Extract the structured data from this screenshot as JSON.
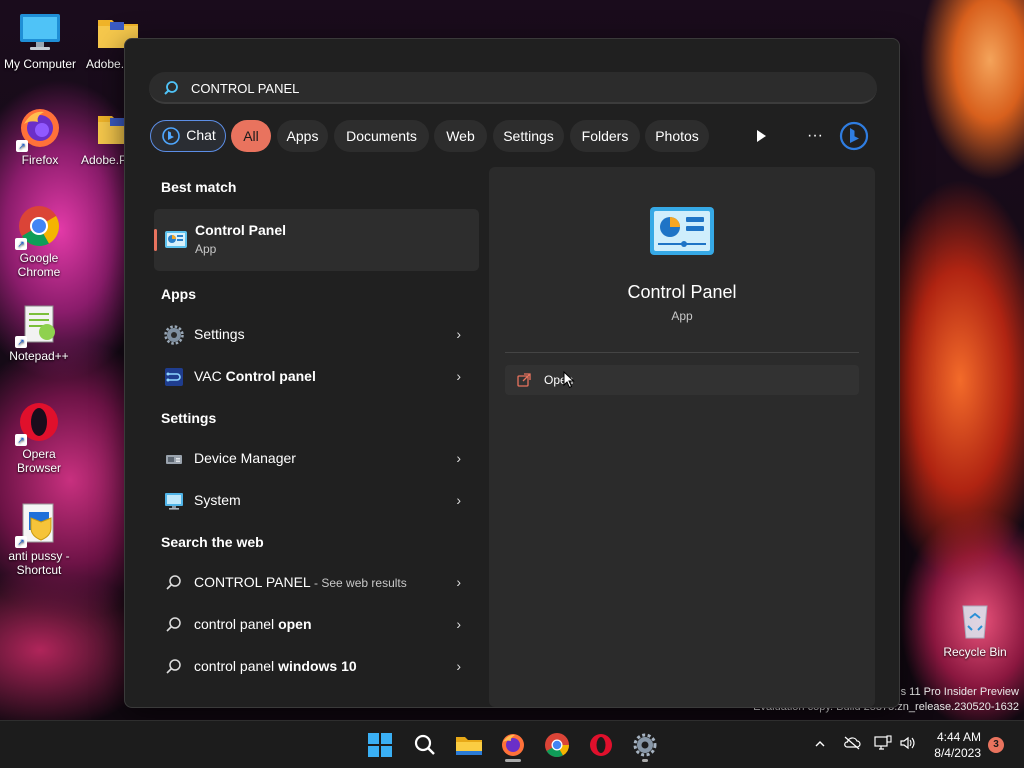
{
  "desktop": {
    "icons": [
      {
        "label": "My Computer"
      },
      {
        "label": "Adobe.I"
      },
      {
        "label": "Firefox"
      },
      {
        "label": "Adobe.P"
      },
      {
        "label": "Google Chrome"
      },
      {
        "label": "Notepad++"
      },
      {
        "label": "Opera Browser"
      },
      {
        "label": "anti pussy - Shortcut"
      },
      {
        "label": "Recycle Bin"
      }
    ],
    "watermark": {
      "line1": "s 11 Pro Insider Preview",
      "line2": "Evaluation copy. Build 25375.zn_release.230520-1632"
    }
  },
  "search": {
    "value": "CONTROL PANEL",
    "placeholder": "",
    "filters": [
      {
        "label": "Chat",
        "active": false
      },
      {
        "label": "All",
        "active": true
      },
      {
        "label": "Apps",
        "active": false
      },
      {
        "label": "Documents",
        "active": false
      },
      {
        "label": "Web",
        "active": false
      },
      {
        "label": "Settings",
        "active": false
      },
      {
        "label": "Folders",
        "active": false
      },
      {
        "label": "Photos",
        "active": false
      }
    ],
    "more_label": "···"
  },
  "results": {
    "best_match_heading": "Best match",
    "best_match": {
      "name": "Control Panel",
      "type": "App"
    },
    "apps_heading": "Apps",
    "apps": [
      {
        "name": "Settings",
        "icon": "gear-icon"
      },
      {
        "pre": "VAC ",
        "bold": "Control panel",
        "icon": "vac-icon"
      }
    ],
    "settings_heading": "Settings",
    "settings": [
      {
        "name": "Device Manager",
        "icon": "device-manager-icon"
      },
      {
        "name": "System",
        "icon": "system-icon"
      }
    ],
    "web_heading": "Search the web",
    "web": [
      {
        "pre": "CONTROL PANEL",
        "bold": "",
        "suffix": " - See web results"
      },
      {
        "pre": "control panel ",
        "bold": "open",
        "suffix": ""
      },
      {
        "pre": "control panel ",
        "bold": "windows 10",
        "suffix": ""
      }
    ]
  },
  "preview": {
    "title": "Control Panel",
    "subtitle": "App",
    "open_label": "Open"
  },
  "taskbar": {
    "time": "4:44 AM",
    "date": "8/4/2023",
    "notifications": "3"
  },
  "colors": {
    "accent": "#e9735e",
    "panel_bg": "#202020",
    "preview_bg": "#2b2b2b"
  }
}
